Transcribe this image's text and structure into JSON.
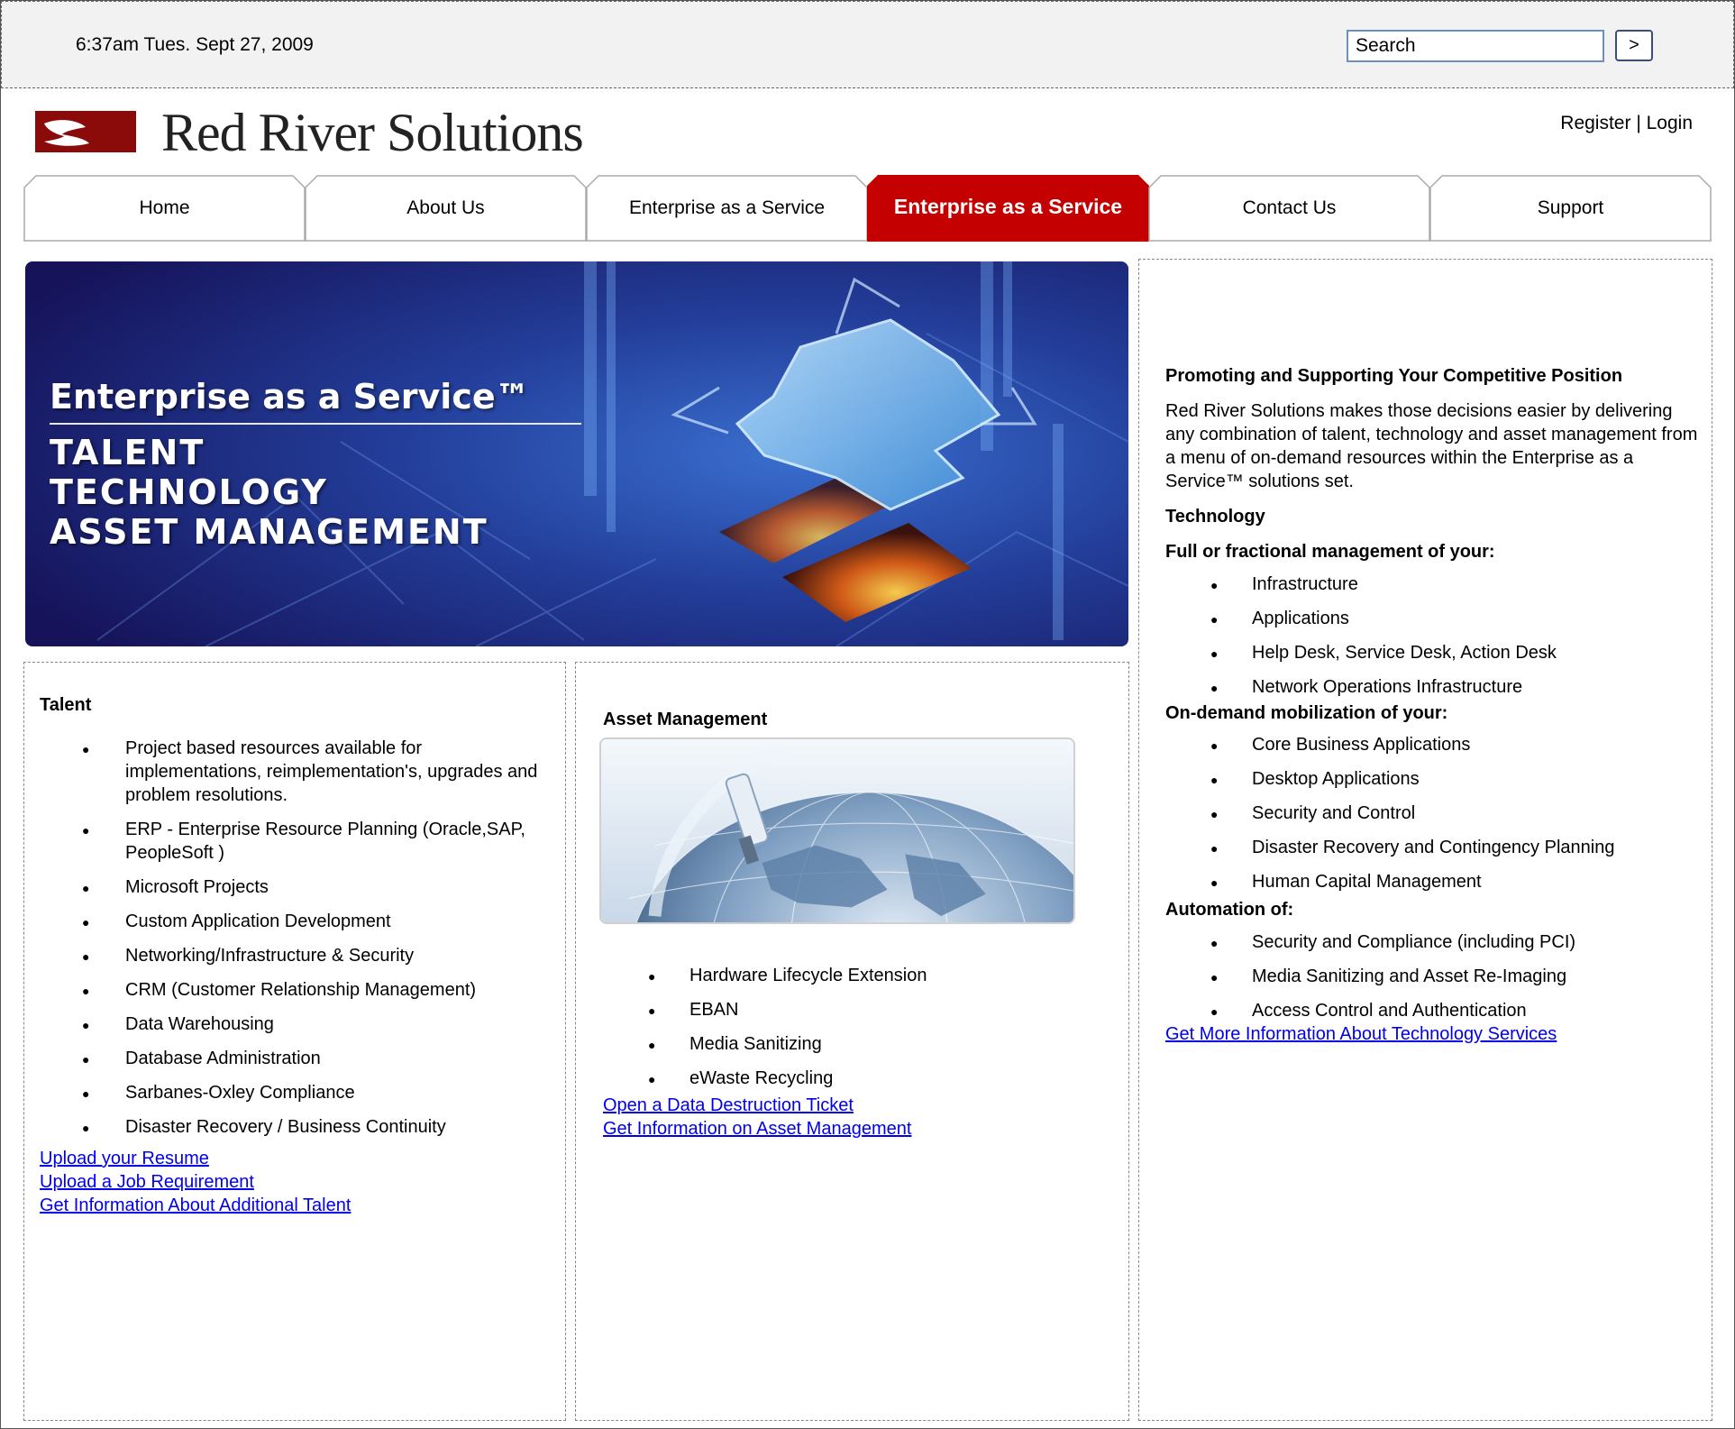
{
  "topbar": {
    "datetime": "6:37am Tues. Sept 27, 2009",
    "search_value": "Search",
    "search_button": ">"
  },
  "header": {
    "logo_text": "Red River Solutions",
    "register": "Register",
    "separator": " | ",
    "login": "Login"
  },
  "nav": {
    "tabs": [
      {
        "label": "Home"
      },
      {
        "label": "About Us"
      },
      {
        "label": "Enterprise as a Service"
      },
      {
        "label": "Enterprise as a Service",
        "active": true
      },
      {
        "label": "Contact Us"
      },
      {
        "label": "Support"
      }
    ]
  },
  "hero": {
    "title": "Enterprise as a Service™",
    "line1": "TALENT",
    "line2": "TECHNOLOGY",
    "line3": "ASSET MANAGEMENT"
  },
  "talent": {
    "heading": "Talent",
    "items": [
      "Project based resources available for implementations, reimplementation's, upgrades and problem resolutions.",
      "ERP - Enterprise Resource Planning (Oracle,SAP, PeopleSoft )",
      "Microsoft Projects",
      "Custom Application Development",
      "Networking/Infrastructure & Security",
      "CRM (Customer Relationship Management)",
      "Data Warehousing",
      "Database Administration",
      "Sarbanes-Oxley Compliance",
      "Disaster Recovery / Business Continuity"
    ],
    "links": [
      "Upload your Resume",
      "Upload a Job Requirement",
      "Get Information About Additional Talent"
    ]
  },
  "asset": {
    "heading": "Asset Management",
    "items": [
      "Hardware Lifecycle Extension",
      "EBAN",
      "Media Sanitizing",
      "eWaste Recycling"
    ],
    "links": [
      "Open a Data Destruction Ticket",
      "Get Information on Asset Management"
    ]
  },
  "technology": {
    "heading": "Promoting and Supporting Your Competitive Position",
    "intro": "Red River Solutions makes those decisions easier by delivering any combination of talent, technology and asset management from a menu of on-demand resources within the Enterprise as a Service™ solutions set.",
    "subheading": "Technology",
    "full_heading": "Full or fractional management of your:",
    "full_items": [
      "Infrastructure",
      "Applications",
      "Help Desk, Service Desk, Action Desk",
      "Network Operations Infrastructure"
    ],
    "mob_heading": "On-demand mobilization of your:",
    "mob_items": [
      "Core Business Applications",
      "Desktop Applications",
      "Security and Control",
      "Disaster Recovery and Contingency Planning",
      "Human Capital Management"
    ],
    "auto_heading": "Automation of:",
    "auto_items": [
      "Security and Compliance (including PCI)",
      "Media Sanitizing and Asset Re-Imaging",
      "Access Control and Authentication"
    ],
    "link": "Get More Information About Technology Services"
  },
  "colors": {
    "accent_red": "#c40000",
    "link_blue": "#0000ee",
    "hero_navy": "#1a1a66"
  }
}
